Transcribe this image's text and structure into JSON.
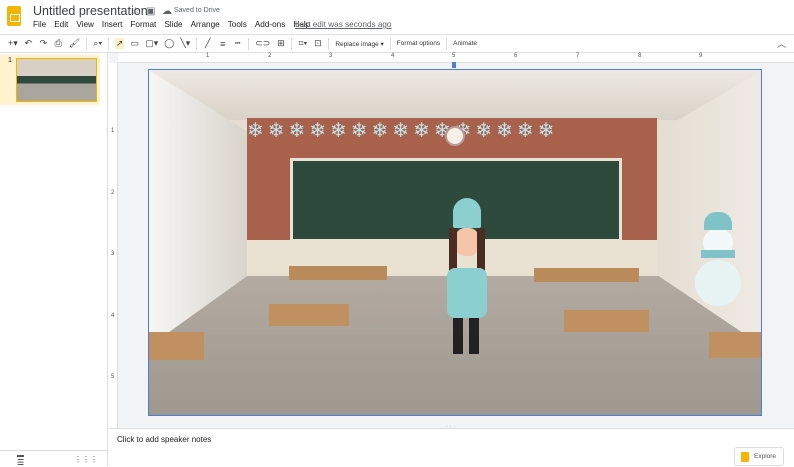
{
  "app": {
    "title": "Untitled presentation",
    "save_status": "Saved to Drive",
    "last_edit": "Last edit was seconds ago"
  },
  "menu": [
    "File",
    "Edit",
    "View",
    "Insert",
    "Format",
    "Slide",
    "Arrange",
    "Tools",
    "Add-ons",
    "Help"
  ],
  "toolbar": {
    "replace_image": "Replace image ▾",
    "format_options": "Format options",
    "animate": "Animate"
  },
  "filmstrip": {
    "slides": [
      {
        "number": "1"
      }
    ]
  },
  "ruler": {
    "h": [
      "1",
      "2",
      "3",
      "4",
      "5",
      "6",
      "7",
      "8",
      "9"
    ],
    "v": [
      "1",
      "2",
      "3",
      "4",
      "5"
    ]
  },
  "notes": {
    "placeholder": "Click to add speaker notes"
  },
  "explore": {
    "label": "Explore"
  },
  "colors": {
    "accent": "#f4b400",
    "selection": "#4a80d8",
    "chalkboard": "#2e4a3d"
  }
}
